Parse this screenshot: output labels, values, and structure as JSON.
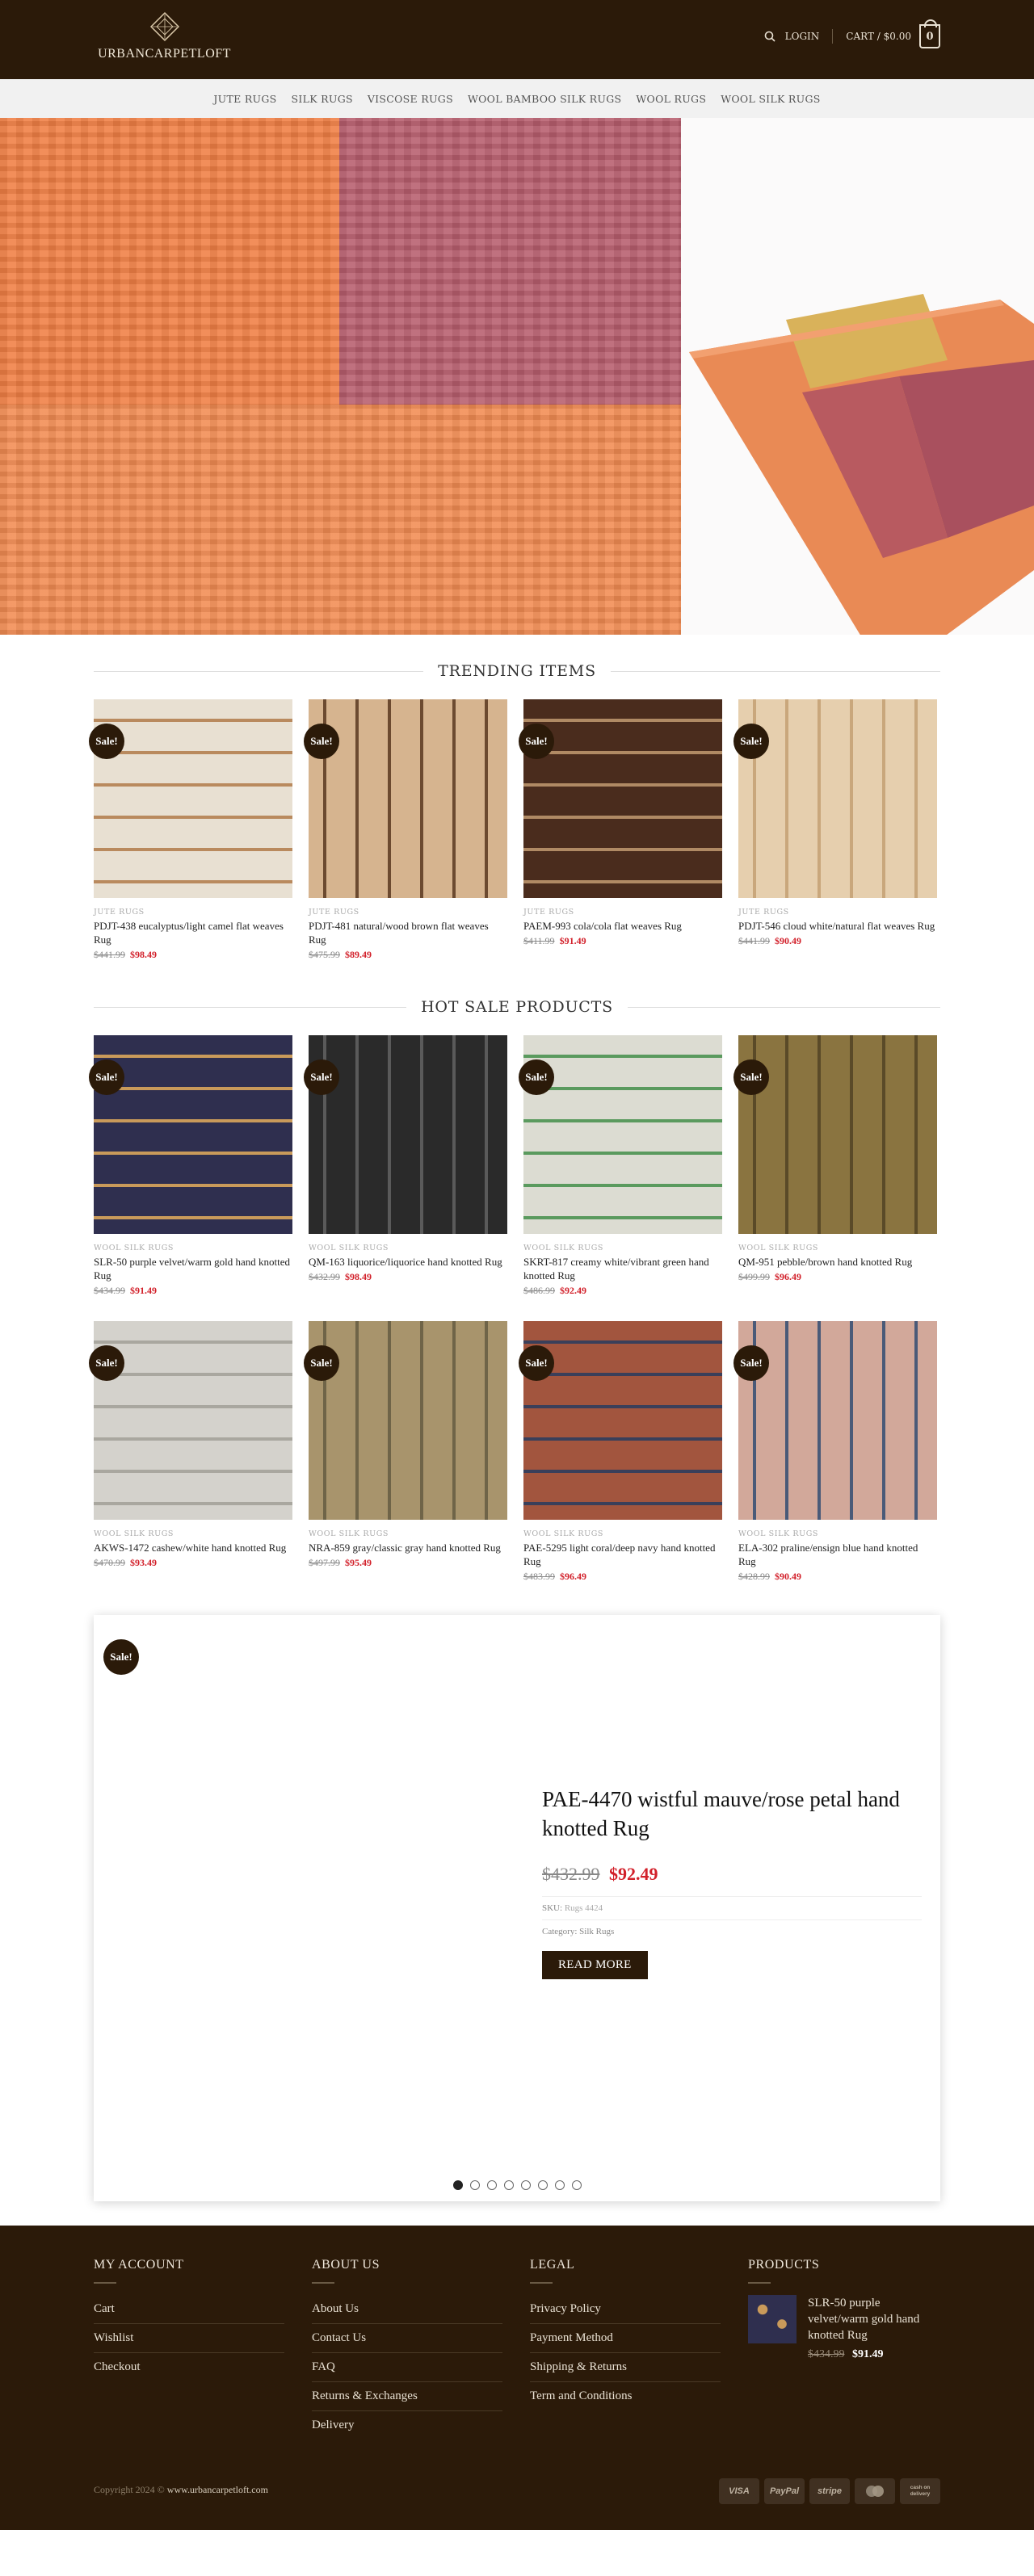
{
  "brand": {
    "name": "URBANCARPETLOFT"
  },
  "header": {
    "login_label": "LOGIN",
    "cart_label": "CART / $0.00",
    "cart_count": "0"
  },
  "nav": {
    "items": [
      "JUTE RUGS",
      "SILK RUGS",
      "VISCOSE RUGS",
      "WOOL BAMBOO SILK RUGS",
      "WOOL RUGS",
      "WOOL SILK RUGS"
    ]
  },
  "sections": {
    "trending_title": "TRENDING ITEMS",
    "hot_sale_title": "HOT SALE PRODUCTS"
  },
  "sale_label": "Sale!",
  "trending": [
    {
      "category": "JUTE RUGS",
      "name": "PDJT-438 eucalyptus/light camel flat weaves Rug",
      "old_price": "$441.99",
      "price": "$98.49",
      "colors": [
        "#e8e0d2",
        "#b98a5e"
      ]
    },
    {
      "category": "JUTE RUGS",
      "name": "PDJT-481 natural/wood brown flat weaves Rug",
      "old_price": "$475.99",
      "price": "$89.49",
      "colors": [
        "#d6b48f",
        "#6c4a30"
      ]
    },
    {
      "category": "JUTE RUGS",
      "name": "PAEM-993 cola/cola flat weaves Rug",
      "old_price": "$411.99",
      "price": "$91.49",
      "colors": [
        "#4a2c1d",
        "#b08a64"
      ]
    },
    {
      "category": "JUTE RUGS",
      "name": "PDJT-546 cloud white/natural flat weaves Rug",
      "old_price": "$441.99",
      "price": "$90.49",
      "colors": [
        "#e6cfae",
        "#c9a77c"
      ]
    }
  ],
  "hot_sale": [
    {
      "category": "WOOL SILK RUGS",
      "name": "SLR-50 purple velvet/warm gold hand knotted Rug",
      "old_price": "$434.99",
      "price": "$91.49",
      "colors": [
        "#2f2f4f",
        "#c99a5a"
      ]
    },
    {
      "category": "WOOL SILK RUGS",
      "name": "QM-163 liquorice/liquorice hand knotted Rug",
      "old_price": "$432.99",
      "price": "$98.49",
      "colors": [
        "#2a2a2a",
        "#5a5a5a"
      ]
    },
    {
      "category": "WOOL SILK RUGS",
      "name": "SKRT-817 creamy white/vibrant green hand knotted Rug",
      "old_price": "$486.99",
      "price": "$92.49",
      "colors": [
        "#dcdcd2",
        "#5a9a5e"
      ]
    },
    {
      "category": "WOOL SILK RUGS",
      "name": "QM-951 pebble/brown hand knotted Rug",
      "old_price": "$499.99",
      "price": "$96.49",
      "colors": [
        "#8a7440",
        "#5a4a28"
      ]
    },
    {
      "category": "WOOL SILK RUGS",
      "name": "AKWS-1472 cashew/white hand knotted Rug",
      "old_price": "$470.99",
      "price": "$93.49",
      "colors": [
        "#d4d2cc",
        "#a9a79f"
      ]
    },
    {
      "category": "WOOL SILK RUGS",
      "name": "NRA-859 gray/classic gray hand knotted Rug",
      "old_price": "$497.99",
      "price": "$95.49",
      "colors": [
        "#a8946c",
        "#6f6448"
      ]
    },
    {
      "category": "WOOL SILK RUGS",
      "name": "PAE-5295 light coral/deep navy hand knotted Rug",
      "old_price": "$483.99",
      "price": "$96.49",
      "colors": [
        "#a2553e",
        "#3a3f5a"
      ]
    },
    {
      "category": "WOOL SILK RUGS",
      "name": "ELA-302 praline/ensign blue hand knotted Rug",
      "old_price": "$428.99",
      "price": "$90.49",
      "colors": [
        "#d2a89a",
        "#4a5a78"
      ]
    }
  ],
  "featured": {
    "title": "PAE-4470 wistful mauve/rose petal hand knotted Rug",
    "old_price": "$432.99",
    "price": "$92.49",
    "sku_label": "SKU:",
    "sku_value": "Rugs 4424",
    "category_label": "Category:",
    "category_value": "Silk Rugs",
    "button_label": "READ MORE",
    "dots_count": 8
  },
  "footer": {
    "my_account": {
      "title": "MY ACCOUNT",
      "links": [
        "Cart",
        "Wishlist",
        "Checkout"
      ]
    },
    "about_us": {
      "title": "ABOUT US",
      "links": [
        "About Us",
        "Contact Us",
        "FAQ",
        "Returns & Exchanges",
        "Delivery"
      ]
    },
    "legal": {
      "title": "LEGAL",
      "links": [
        "Privacy Policy",
        "Payment Method",
        "Shipping & Returns",
        "Term and Conditions"
      ]
    },
    "products": {
      "title": "PRODUCTS",
      "name": "SLR-50 purple velvet/warm gold hand knotted Rug",
      "old_price": "$434.99",
      "price": "$91.49"
    },
    "copyright_prefix": "Copyright 2024 © ",
    "copyright_site": "www.urbancarpetloft.com",
    "payments": [
      "VISA",
      "PayPal",
      "stripe",
      "mastercard",
      "cash on delivery"
    ]
  },
  "colors": {
    "brand_dark": "#2b1a09",
    "sale_red": "#d2202a"
  }
}
